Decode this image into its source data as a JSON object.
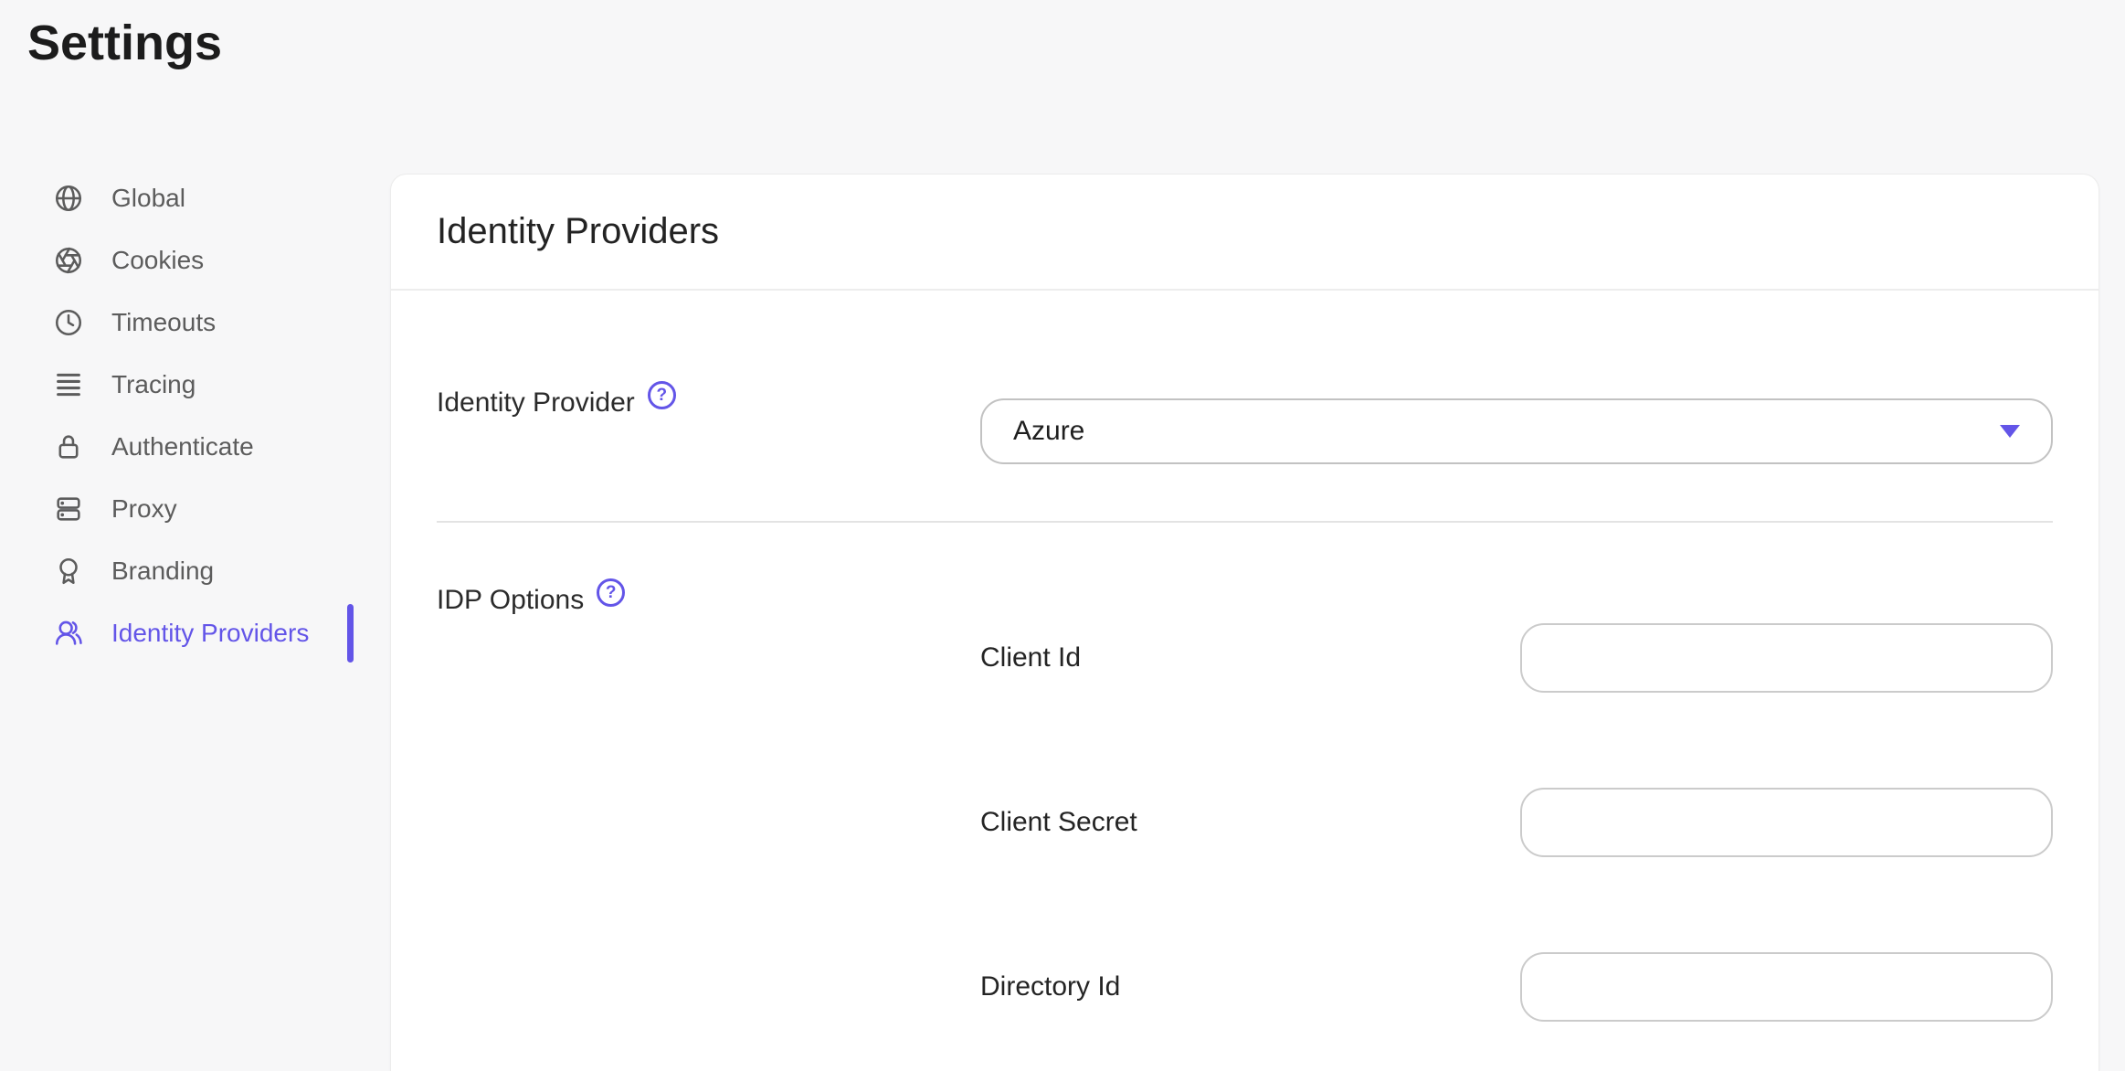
{
  "app": {
    "title": "Settings"
  },
  "colors": {
    "accent": "#6355e8",
    "background": "#f7f7f8",
    "card": "#ffffff",
    "sidebar_text": "#5c5c5c"
  },
  "icons": {
    "help_glyph": "?"
  },
  "sidebar": {
    "items": [
      {
        "label": "Global",
        "icon": "globe-icon",
        "active": false
      },
      {
        "label": "Cookies",
        "icon": "aperture-icon",
        "active": false
      },
      {
        "label": "Timeouts",
        "icon": "clock-icon",
        "active": false
      },
      {
        "label": "Tracing",
        "icon": "tracing-lines-icon",
        "active": false
      },
      {
        "label": "Authenticate",
        "icon": "lock-icon",
        "active": false
      },
      {
        "label": "Proxy",
        "icon": "server-icon",
        "active": false
      },
      {
        "label": "Branding",
        "icon": "award-icon",
        "active": false
      },
      {
        "label": "Identity Providers",
        "icon": "users-icon",
        "active": true
      }
    ]
  },
  "panel": {
    "title": "Identity Providers",
    "identity_provider": {
      "label": "Identity Provider",
      "value": "Azure"
    },
    "idp_options": {
      "label": "IDP Options",
      "fields": [
        {
          "label": "Client Id",
          "value": ""
        },
        {
          "label": "Client Secret",
          "value": ""
        },
        {
          "label": "Directory Id",
          "value": ""
        }
      ]
    }
  }
}
